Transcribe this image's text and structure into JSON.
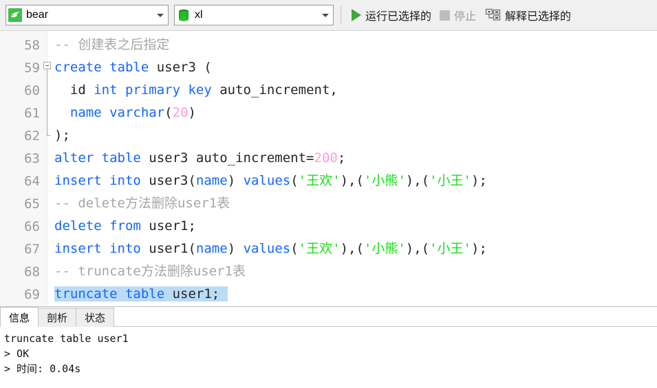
{
  "toolbar": {
    "connection": {
      "icon": "mysql-dolphin-icon",
      "value": "bear"
    },
    "database": {
      "icon": "database-cylinder-icon",
      "value": "xl"
    },
    "run_selected": {
      "label": "运行已选择的",
      "icon": "play-icon",
      "color": "#3ea83e"
    },
    "stop": {
      "label": "停止",
      "icon": "stop-icon",
      "color": "#bdbdbd",
      "disabled": true
    },
    "explain_selected": {
      "label": "解释已选择的",
      "icon": "explain-plan-icon"
    }
  },
  "editor": {
    "colors": {
      "keyword": "#1565ff",
      "number": "#ff9ed6",
      "string": "#19dd19",
      "comment": "#a6a6a6",
      "plain": "#242424",
      "selection": "#bbdcf7",
      "gutter_bg": "#f7f7f7",
      "line_number": "#9a9a9a"
    },
    "first_line_number": 58,
    "lines": [
      {
        "n": "58",
        "fold": "none",
        "tokens": [
          {
            "t": "-- 创建表之后指定",
            "c": "cmt"
          }
        ]
      },
      {
        "n": "59",
        "fold": "start",
        "tokens": [
          {
            "t": "create table",
            "c": "kw"
          },
          {
            "t": " user3 (",
            "c": "pl"
          }
        ]
      },
      {
        "n": "60",
        "fold": "mid",
        "tokens": [
          {
            "t": "  id ",
            "c": "pl"
          },
          {
            "t": "int primary key",
            "c": "kw"
          },
          {
            "t": " auto_increment,",
            "c": "pl"
          }
        ]
      },
      {
        "n": "61",
        "fold": "mid",
        "tokens": [
          {
            "t": "  ",
            "c": "pl"
          },
          {
            "t": "name varchar",
            "c": "kw"
          },
          {
            "t": "(",
            "c": "pl"
          },
          {
            "t": "20",
            "c": "num"
          },
          {
            "t": ")",
            "c": "pl"
          }
        ]
      },
      {
        "n": "62",
        "fold": "end",
        "tokens": [
          {
            "t": ");",
            "c": "pl"
          }
        ]
      },
      {
        "n": "63",
        "fold": "none",
        "tokens": [
          {
            "t": "alter table",
            "c": "kw"
          },
          {
            "t": " user3 auto_increment=",
            "c": "pl"
          },
          {
            "t": "200",
            "c": "num"
          },
          {
            "t": ";",
            "c": "pl"
          }
        ]
      },
      {
        "n": "64",
        "fold": "none",
        "tokens": [
          {
            "t": "insert into",
            "c": "kw"
          },
          {
            "t": " user3(",
            "c": "pl"
          },
          {
            "t": "name",
            "c": "kw"
          },
          {
            "t": ") ",
            "c": "pl"
          },
          {
            "t": "values",
            "c": "kw"
          },
          {
            "t": "(",
            "c": "pl"
          },
          {
            "t": "'王欢'",
            "c": "str"
          },
          {
            "t": "),(",
            "c": "pl"
          },
          {
            "t": "'小熊'",
            "c": "str"
          },
          {
            "t": "),(",
            "c": "pl"
          },
          {
            "t": "'小王'",
            "c": "str"
          },
          {
            "t": ");",
            "c": "pl"
          }
        ]
      },
      {
        "n": "65",
        "fold": "none",
        "tokens": [
          {
            "t": "-- delete方法删除user1表",
            "c": "cmt"
          }
        ]
      },
      {
        "n": "66",
        "fold": "none",
        "tokens": [
          {
            "t": "delete from",
            "c": "kw"
          },
          {
            "t": " user1;",
            "c": "pl"
          }
        ]
      },
      {
        "n": "67",
        "fold": "none",
        "tokens": [
          {
            "t": "insert into",
            "c": "kw"
          },
          {
            "t": " user1(",
            "c": "pl"
          },
          {
            "t": "name",
            "c": "kw"
          },
          {
            "t": ") ",
            "c": "pl"
          },
          {
            "t": "values",
            "c": "kw"
          },
          {
            "t": "(",
            "c": "pl"
          },
          {
            "t": "'王欢'",
            "c": "str"
          },
          {
            "t": "),(",
            "c": "pl"
          },
          {
            "t": "'小熊'",
            "c": "str"
          },
          {
            "t": "),(",
            "c": "pl"
          },
          {
            "t": "'小王'",
            "c": "str"
          },
          {
            "t": ");",
            "c": "pl"
          }
        ]
      },
      {
        "n": "68",
        "fold": "none",
        "tokens": [
          {
            "t": "-- truncate方法删除user1表",
            "c": "cmt"
          }
        ]
      },
      {
        "n": "69",
        "fold": "none",
        "selected": true,
        "tokens": [
          {
            "t": "truncate table",
            "c": "kw"
          },
          {
            "t": " user1; ",
            "c": "pl"
          }
        ]
      }
    ]
  },
  "bottom_panel": {
    "tabs": [
      {
        "label": "信息",
        "active": true
      },
      {
        "label": "剖析",
        "active": false
      },
      {
        "label": "状态",
        "active": false
      }
    ],
    "log_lines": [
      "truncate table user1",
      "> OK",
      "> 时间: 0.04s"
    ]
  }
}
